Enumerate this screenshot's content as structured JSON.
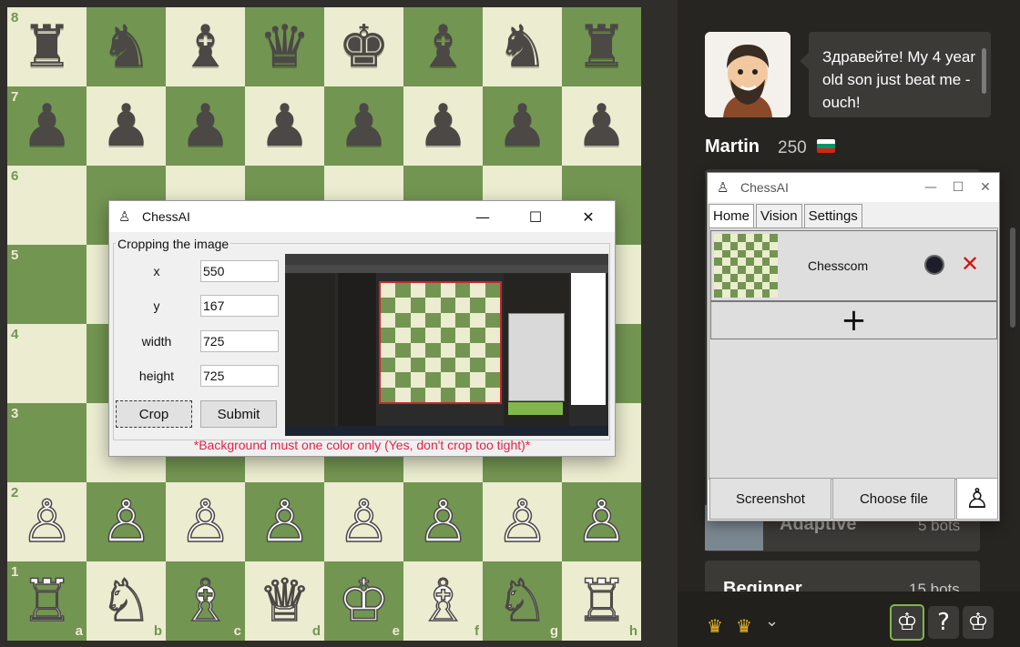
{
  "board": {
    "ranks": [
      "8",
      "7",
      "6",
      "5",
      "4",
      "3",
      "2",
      "1"
    ],
    "files": [
      "a",
      "b",
      "c",
      "d",
      "e",
      "f",
      "g",
      "h"
    ],
    "position": [
      [
        "♜",
        "♞",
        "♝",
        "♛",
        "♚",
        "♝",
        "♞",
        "♜"
      ],
      [
        "♟",
        "♟",
        "♟",
        "♟",
        "♟",
        "♟",
        "♟",
        "♟"
      ],
      [
        "",
        "",
        "",
        "",
        "",
        "",
        "",
        ""
      ],
      [
        "",
        "",
        "",
        "",
        "",
        "",
        "",
        ""
      ],
      [
        "",
        "",
        "",
        "",
        "",
        "",
        "",
        ""
      ],
      [
        "",
        "",
        "",
        "",
        "",
        "",
        "",
        ""
      ],
      [
        "♙",
        "♙",
        "♙",
        "♙",
        "♙",
        "♙",
        "♙",
        "♙"
      ],
      [
        "♖",
        "♘",
        "♗",
        "♕",
        "♔",
        "♗",
        "♘",
        "♖"
      ]
    ],
    "colors": {
      "light": "#ebecd0",
      "dark": "#739552"
    }
  },
  "crop_window": {
    "title": "ChessAI",
    "icon": "chess-pawn-icon",
    "controls": {
      "minimize": "—",
      "maximize": "☐",
      "close": "✕"
    },
    "group_label": "Cropping the image",
    "fields": [
      {
        "label": "x",
        "value": "550"
      },
      {
        "label": "y",
        "value": "167"
      },
      {
        "label": "width",
        "value": "725"
      },
      {
        "label": "height",
        "value": "725"
      }
    ],
    "crop_label": "Crop",
    "submit_label": "Submit",
    "warning": "*Background must one color only (Yes, don't crop too tight)*"
  },
  "coach": {
    "message": "Здравейте! My 4 year old son just beat me - ouch!",
    "name": "Martin",
    "rating": "250",
    "flag_colors": [
      "#ffffff",
      "#00966e",
      "#d62612"
    ]
  },
  "bot_list": {
    "adaptive_label": "Adaptive",
    "adaptive_count": "5 bots",
    "beginner_label": "Beginner",
    "beginner_count": "15 bots"
  },
  "bottom_bar": {
    "crowns": [
      "♛",
      "♛"
    ],
    "chevron": "⌄",
    "modes": [
      "♔",
      "?",
      "♔"
    ]
  },
  "main_window": {
    "title": "ChessAI",
    "controls": {
      "minimize": "—",
      "maximize": "☐",
      "close": "✕"
    },
    "tabs": [
      "Home",
      "Vision",
      "Settings"
    ],
    "active_tab": "Home",
    "profile": {
      "name": "Chesscom",
      "color": "#1d1d2b"
    },
    "add_symbol": "+",
    "screenshot_label": "Screenshot",
    "choose_file_label": "Choose file",
    "pawn_symbol": "♙"
  }
}
